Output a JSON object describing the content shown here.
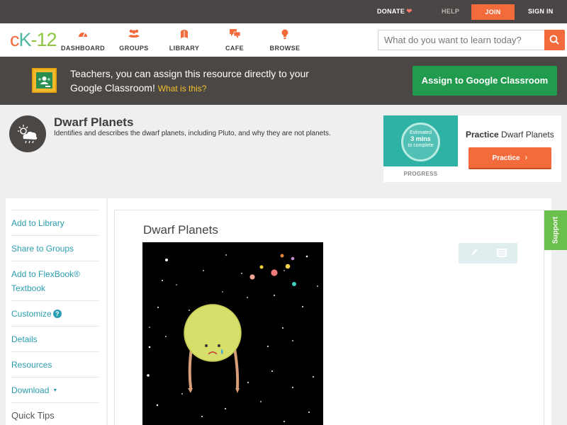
{
  "topbar": {
    "donate": "DONATE",
    "help": "HELP",
    "join": "JOIN",
    "sign_in": "SIGN IN"
  },
  "nav": {
    "logo": {
      "c": "c",
      "k": "K",
      "n": "-12"
    },
    "items": [
      {
        "label": "DASHBOARD",
        "icon": "dashboard-icon"
      },
      {
        "label": "GROUPS",
        "icon": "groups-icon"
      },
      {
        "label": "LIBRARY",
        "icon": "library-icon"
      },
      {
        "label": "CAFE",
        "icon": "cafe-icon"
      },
      {
        "label": "BROWSE",
        "icon": "browse-icon"
      }
    ],
    "search_placeholder": "What do you want to learn today?"
  },
  "banner": {
    "message": "Teachers, you can assign this resource directly to your Google Classroom!",
    "what_link": "What is this?",
    "assign_button": "Assign to Google Classroom"
  },
  "header": {
    "title": "Dwarf Planets",
    "description": "Identifies and describes the dwarf planets, including Pluto, and why they are not planets."
  },
  "practice": {
    "estimate_line1": "Estimated",
    "estimate_line2": "3 mins",
    "estimate_line3": "to complete",
    "progress_label": "PROGRESS",
    "title_bold": "Practice",
    "title_rest": "Dwarf Planets",
    "button": "Practice"
  },
  "sidebar": {
    "items": [
      {
        "label": "Add to Library"
      },
      {
        "label": "Share to Groups"
      },
      {
        "label": "Add to FlexBook®",
        "label2": "Textbook"
      },
      {
        "label": "Customize"
      },
      {
        "label": "Details"
      },
      {
        "label": "Resources"
      },
      {
        "label": "Download"
      },
      {
        "label": "Quick Tips"
      }
    ],
    "help_glyph": "?"
  },
  "content": {
    "title": "Dwarf Planets"
  },
  "support": "Support",
  "colors": {
    "accent": "#f36a3b",
    "teal": "#2a9db0",
    "google_green": "#219b4e",
    "dark_bar": "#4a4645",
    "support_green": "#6bbf4c"
  }
}
